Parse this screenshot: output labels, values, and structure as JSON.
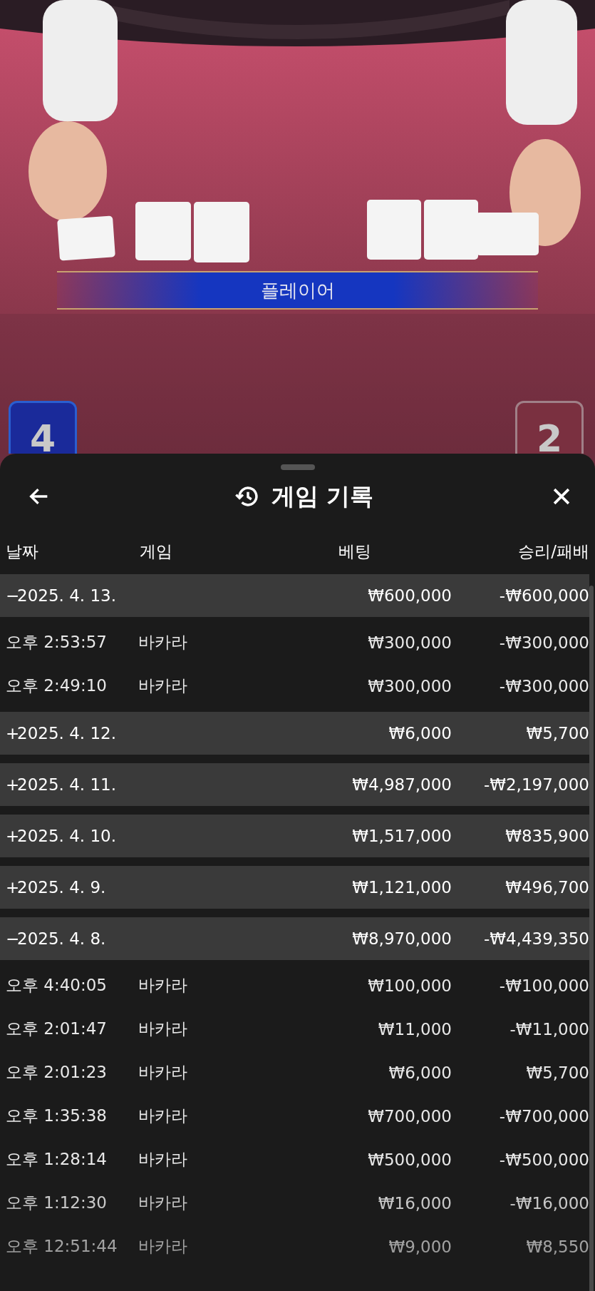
{
  "video": {
    "kind": "picture",
    "result_banner": "플레이어",
    "scores": [
      {
        "kind": "player",
        "value": "4"
      },
      {
        "kind": "banker",
        "value": "2"
      }
    ]
  },
  "sheet": {
    "title": "게임 기록",
    "columns": [
      "날짜",
      "게임",
      "베팅",
      "승리/패배"
    ],
    "groups": [
      {
        "toggle": "−",
        "date": "2025. 4. 13.",
        "bet": "₩600,000",
        "result": "-₩600,000",
        "expanded": true,
        "children": [
          {
            "time": "오후 2:53:57",
            "game": "바카라",
            "bet": "₩300,000",
            "result": "-₩300,000"
          },
          {
            "time": "오후 2:49:10",
            "game": "바카라",
            "bet": "₩300,000",
            "result": "-₩300,000"
          }
        ]
      },
      {
        "toggle": "+",
        "date": "2025. 4. 12.",
        "bet": "₩6,000",
        "result": "₩5,700",
        "expanded": false
      },
      {
        "toggle": "+",
        "date": "2025. 4. 11.",
        "bet": "₩4,987,000",
        "result": "-₩2,197,000",
        "expanded": false
      },
      {
        "toggle": "+",
        "date": "2025. 4. 10.",
        "bet": "₩1,517,000",
        "result": "₩835,900",
        "expanded": false
      },
      {
        "toggle": "+",
        "date": "2025. 4. 9.",
        "bet": "₩1,121,000",
        "result": "₩496,700",
        "expanded": false
      },
      {
        "toggle": "−",
        "date": "2025. 4. 8.",
        "bet": "₩8,970,000",
        "result": "-₩4,439,350",
        "expanded": true,
        "children": [
          {
            "time": "오후 4:40:05",
            "game": "바카라",
            "bet": "₩100,000",
            "result": "-₩100,000"
          },
          {
            "time": "오후 2:01:47",
            "game": "바카라",
            "bet": "₩11,000",
            "result": "-₩11,000"
          },
          {
            "time": "오후 2:01:23",
            "game": "바카라",
            "bet": "₩6,000",
            "result": "₩5,700"
          },
          {
            "time": "오후 1:35:38",
            "game": "바카라",
            "bet": "₩700,000",
            "result": "-₩700,000"
          },
          {
            "time": "오후 1:28:14",
            "game": "바카라",
            "bet": "₩500,000",
            "result": "-₩500,000"
          },
          {
            "time": "오후 1:12:30",
            "game": "바카라",
            "bet": "₩16,000",
            "result": "-₩16,000"
          },
          {
            "time": "오후 12:51:44",
            "game": "바카라",
            "bet": "₩9,000",
            "result": "₩8,550"
          }
        ]
      }
    ]
  }
}
